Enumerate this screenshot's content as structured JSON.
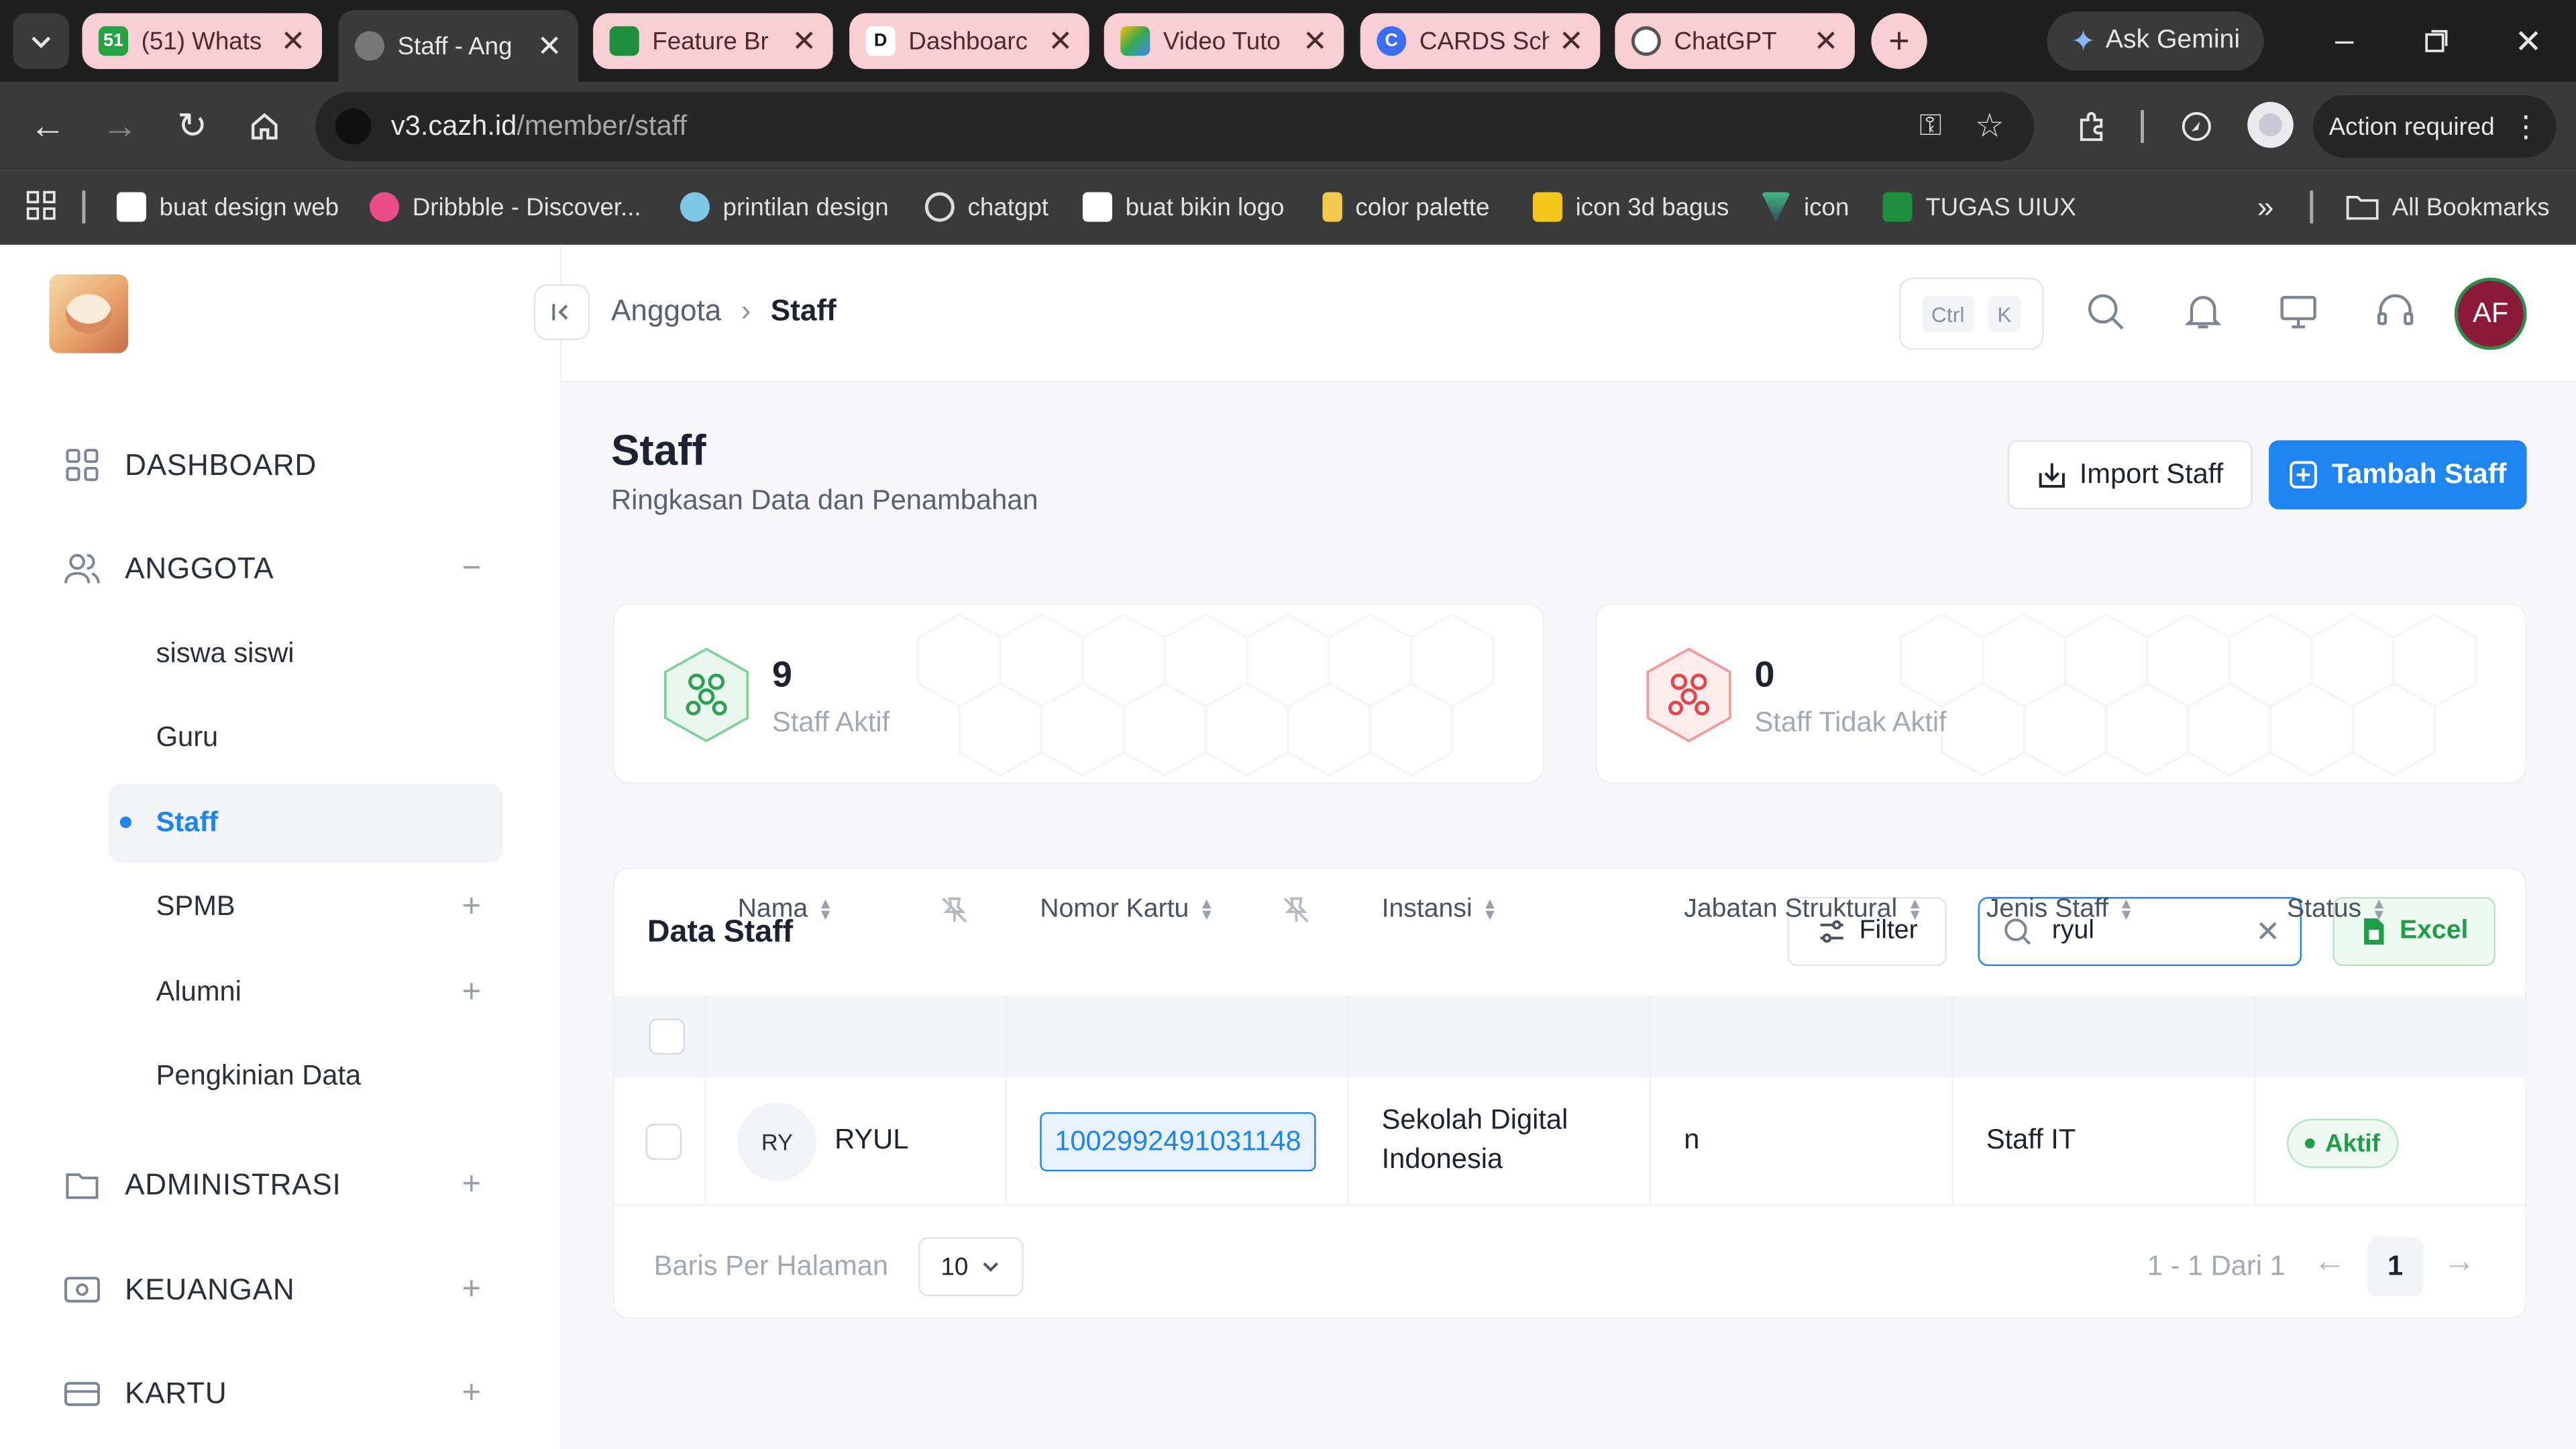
{
  "browser": {
    "tabs": [
      {
        "title": "(51) Whats"
      },
      {
        "title": "Staff - Ang"
      },
      {
        "title": "Feature Br"
      },
      {
        "title": "Dashboarc"
      },
      {
        "title": "Video Tuto"
      },
      {
        "title": "CARDS Sch"
      },
      {
        "title": "ChatGPT"
      }
    ],
    "gemini_label": "Ask Gemini",
    "url_host": "v3.cazh.id",
    "url_path": "/member/staff",
    "action_required": "Action required",
    "bookmarks": [
      {
        "label": "buat design web"
      },
      {
        "label": "Dribbble - Discover..."
      },
      {
        "label": "printilan design"
      },
      {
        "label": "chatgpt"
      },
      {
        "label": "buat bikin logo"
      },
      {
        "label": "color palette"
      },
      {
        "label": "icon 3d bagus"
      },
      {
        "label": "icon"
      },
      {
        "label": "TUGAS UIUX"
      }
    ],
    "all_bookmarks": "All Bookmarks"
  },
  "sidebar": {
    "main": [
      {
        "label": "DASHBOARD",
        "icon": "grid-icon"
      },
      {
        "label": "ANGGOTA",
        "icon": "users-icon"
      },
      {
        "label": "ADMINISTRASI",
        "icon": "folder-icon"
      },
      {
        "label": "KEUANGAN",
        "icon": "wallet-icon"
      },
      {
        "label": "KARTU",
        "icon": "card-icon"
      }
    ],
    "anggota_sub": [
      {
        "label": "siswa siswi"
      },
      {
        "label": "Guru"
      },
      {
        "label": "Staff"
      },
      {
        "label": "SPMB"
      },
      {
        "label": "Alumni"
      },
      {
        "label": "Pengkinian Data"
      }
    ]
  },
  "header": {
    "breadcrumb": [
      "Anggota",
      "Staff"
    ],
    "kbd": [
      "Ctrl",
      "K"
    ],
    "avatar_initials": "AF"
  },
  "page": {
    "title": "Staff",
    "subtitle": "Ringkasan Data dan Penambahan",
    "import_label": "Import Staff",
    "add_label": "Tambah Staff"
  },
  "stats": [
    {
      "value": "9",
      "label": "Staff Aktif",
      "color": "#2f9e57"
    },
    {
      "value": "0",
      "label": "Staff Tidak Aktif",
      "color": "#e0474c"
    }
  ],
  "table": {
    "title": "Data Staff",
    "filter_label": "Filter",
    "search_value": "ryul",
    "excel_label": "Excel",
    "columns": [
      "Nama",
      "Nomor Kartu",
      "Instansi",
      "Jabatan Struktural",
      "Jenis Staff",
      "Status"
    ],
    "rows": [
      {
        "initials": "RY",
        "nama": "RYUL",
        "nomor_kartu": "1002992491031148",
        "instansi_line1": "Sekolah Digital",
        "instansi_line2": "Indonesia",
        "jabatan": "n",
        "jenis": "Staff IT",
        "status": "Aktif"
      }
    ],
    "per_page_label": "Baris Per Halaman",
    "per_page_value": "10",
    "range_label": "1 - 1 Dari 1",
    "current_page": "1"
  },
  "colors": {
    "primary": "#1e84f0",
    "success": "#1f9d48",
    "danger": "#e0474c",
    "avatar": "#8b1a3a"
  }
}
